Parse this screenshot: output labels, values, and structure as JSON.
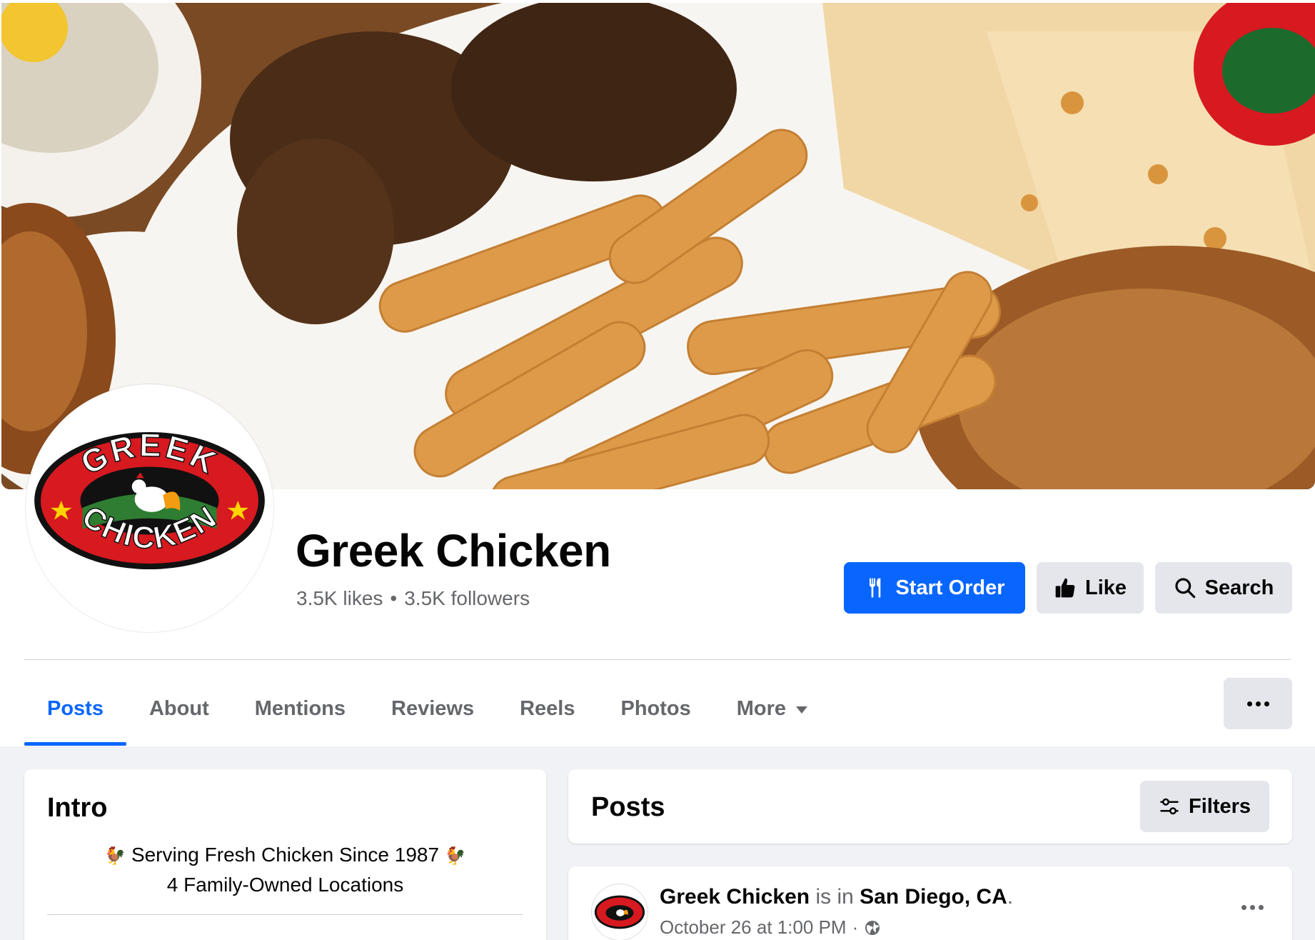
{
  "page": {
    "name": "Greek Chicken",
    "likes": "3.5K likes",
    "separator": "•",
    "followers": "3.5K followers"
  },
  "logo": {
    "top_text": "GREEK",
    "bottom_text": "CHICKEN",
    "colors": {
      "red": "#d71920",
      "black": "#111111",
      "yellow": "#ffd400",
      "green": "#2e7d32"
    }
  },
  "actions": {
    "start_order": "Start Order",
    "like": "Like",
    "search": "Search",
    "primary_color": "#0866ff"
  },
  "tabs": [
    {
      "label": "Posts",
      "active": true
    },
    {
      "label": "About"
    },
    {
      "label": "Mentions"
    },
    {
      "label": "Reviews"
    },
    {
      "label": "Reels"
    },
    {
      "label": "Photos"
    },
    {
      "label": "More"
    }
  ],
  "intro": {
    "title": "Intro",
    "bio_line1": "Serving Fresh Chicken Since 1987",
    "bio_line2": "4 Family-Owned Locations",
    "bio_emoji": "🐓"
  },
  "posts_section": {
    "title": "Posts",
    "filters_label": "Filters"
  },
  "post": {
    "author": "Greek Chicken",
    "connector": "is in",
    "location": "San Diego, CA",
    "period": ".",
    "timestamp": "October 26 at 1:00 PM",
    "separator": "·",
    "audience_icon": "globe-icon"
  }
}
